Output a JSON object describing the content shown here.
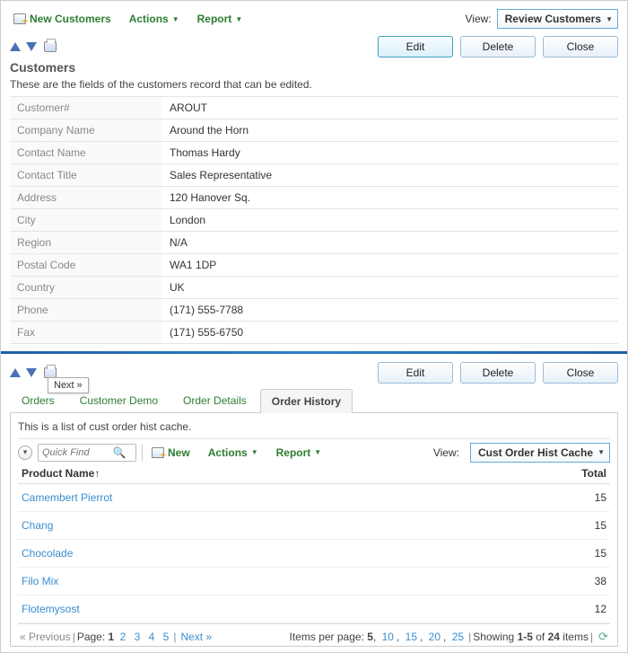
{
  "top": {
    "new_customers": "New Customers",
    "actions": "Actions",
    "report": "Report",
    "view_label": "View:",
    "view_value": "Review Customers"
  },
  "buttons": {
    "edit": "Edit",
    "delete": "Delete",
    "close": "Close"
  },
  "customers": {
    "title": "Customers",
    "desc": "These are the fields of the customers record that can be edited.",
    "fields": [
      {
        "label": "Customer#",
        "value": "AROUT"
      },
      {
        "label": "Company Name",
        "value": "Around the Horn"
      },
      {
        "label": "Contact Name",
        "value": "Thomas Hardy"
      },
      {
        "label": "Contact Title",
        "value": "Sales Representative"
      },
      {
        "label": "Address",
        "value": "120 Hanover Sq."
      },
      {
        "label": "City",
        "value": "London"
      },
      {
        "label": "Region",
        "value": "N/A"
      },
      {
        "label": "Postal Code",
        "value": "WA1 1DP"
      },
      {
        "label": "Country",
        "value": "UK"
      },
      {
        "label": "Phone",
        "value": "(171) 555-7788"
      },
      {
        "label": "Fax",
        "value": "(171) 555-6750"
      }
    ]
  },
  "tabs": {
    "items": [
      "Orders",
      "Customer Demo",
      "Order Details",
      "Order History"
    ],
    "active": 3,
    "tooltip": "Next »"
  },
  "detail": {
    "desc": "This is a list of cust order hist cache.",
    "quickfind_placeholder": "Quick Find",
    "new": "New",
    "actions": "Actions",
    "report": "Report",
    "view_label": "View:",
    "view_value": "Cust Order Hist Cache"
  },
  "grid": {
    "col_name": "Product Name",
    "sort_indicator": "↑",
    "col_total": "Total",
    "rows": [
      {
        "name": "Camembert Pierrot",
        "total": 15
      },
      {
        "name": "Chang",
        "total": 15
      },
      {
        "name": "Chocolade",
        "total": 15
      },
      {
        "name": "Filo Mix",
        "total": 38
      },
      {
        "name": "Flotemysost",
        "total": 12
      }
    ]
  },
  "pager": {
    "prev": "« Previous",
    "page_label": "Page:",
    "pages": [
      "1",
      "2",
      "3",
      "4",
      "5"
    ],
    "current": 1,
    "next": "Next »",
    "ipp_label": "Items per page:",
    "ipp_options": [
      "5",
      "10",
      "15",
      "20",
      "25"
    ],
    "ipp_current": "5",
    "showing_prefix": "Showing ",
    "showing_range": "1-5",
    "showing_mid": " of ",
    "showing_total": "24",
    "showing_suffix": " items"
  }
}
